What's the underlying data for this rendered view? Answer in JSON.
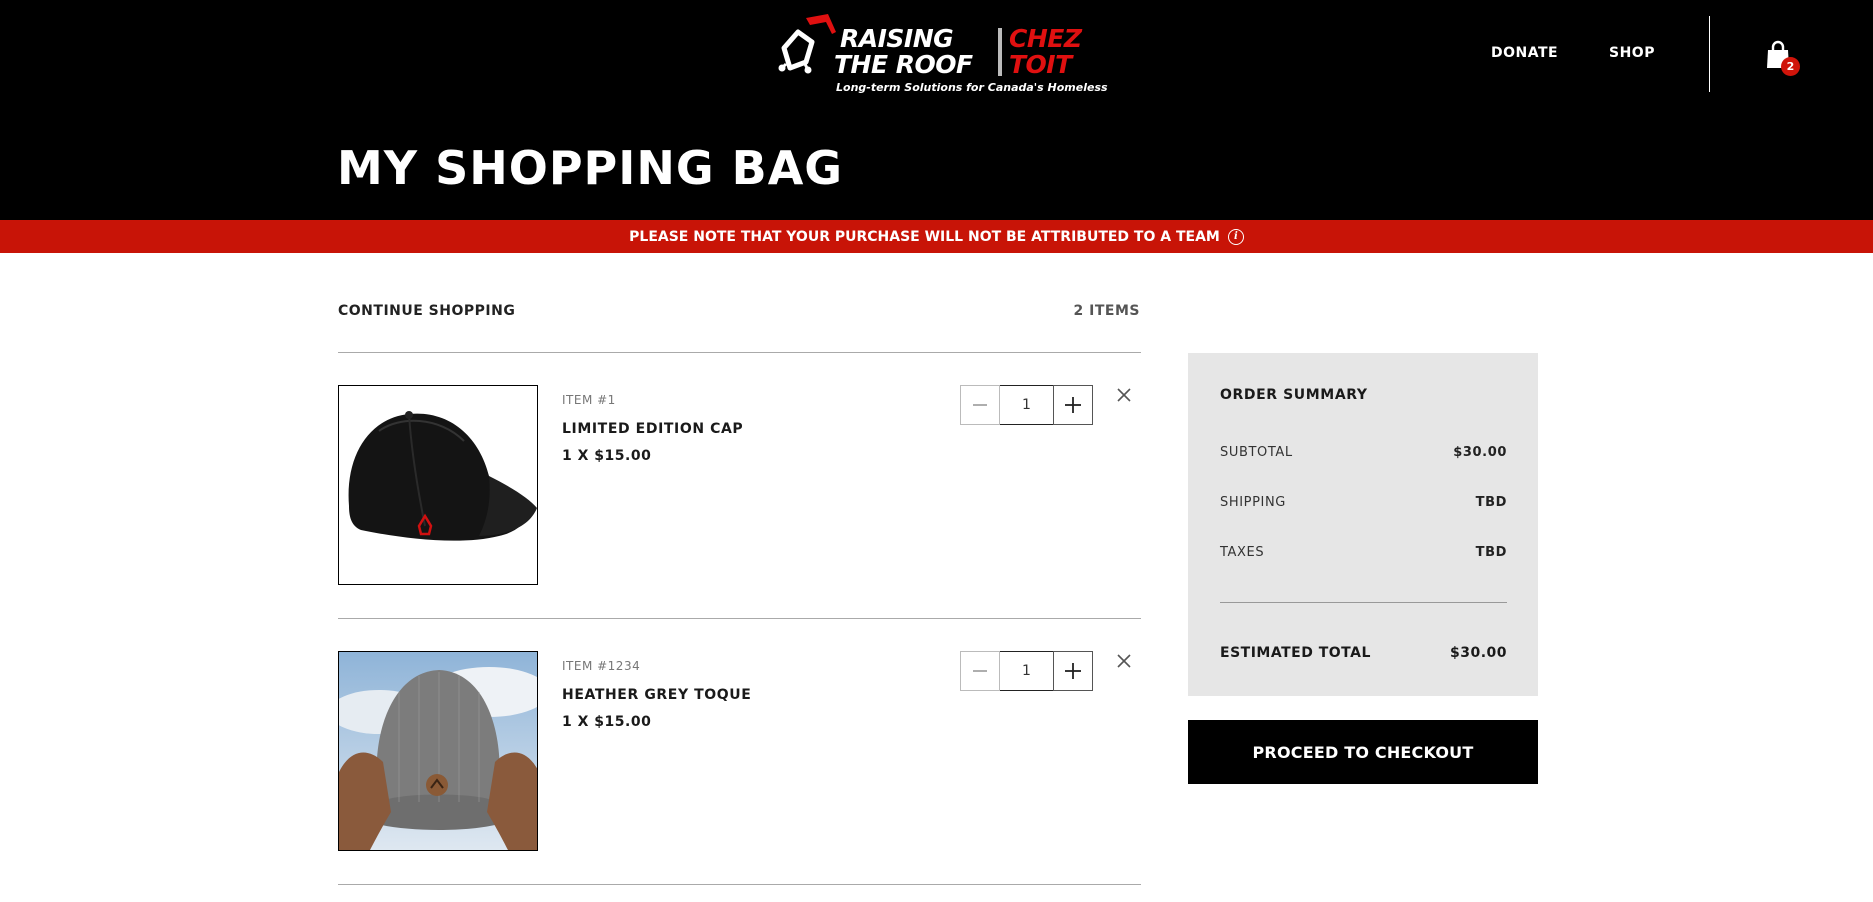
{
  "brand": {
    "line1": "RAISING",
    "line2": "THE ROOF",
    "fr_line1": "CHEZ",
    "fr_line2": "TOIT",
    "tagline": "Long-term Solutions for Canada's Homeless"
  },
  "nav": {
    "donate": "DONATE",
    "shop": "SHOP",
    "cart_count": "2"
  },
  "page": {
    "title": "MY SHOPPING BAG"
  },
  "notice": {
    "text": "PLEASE NOTE THAT YOUR PURCHASE WILL NOT BE ATTRIBUTED TO A TEAM",
    "icon": "info-icon",
    "icon_glyph": "i"
  },
  "cart": {
    "continue_label": "CONTINUE SHOPPING",
    "item_count": "2 ITEMS",
    "items": [
      {
        "number": "ITEM #1",
        "name": "LIMITED EDITION CAP",
        "price": "1 X $15.00",
        "quantity": "1",
        "image": "black-cap-image"
      },
      {
        "number": "ITEM #1234",
        "name": "HEATHER GREY TOQUE",
        "price": "1 X $15.00",
        "quantity": "1",
        "image": "grey-toque-image"
      }
    ]
  },
  "summary": {
    "title": "ORDER SUMMARY",
    "subtotal_label": "SUBTOTAL",
    "subtotal_value": "$30.00",
    "shipping_label": "SHIPPING",
    "shipping_value": "TBD",
    "taxes_label": "TAXES",
    "taxes_value": "TBD",
    "total_label": "ESTIMATED TOTAL",
    "total_value": "$30.00",
    "checkout_label": "PROCEED TO CHECKOUT"
  },
  "colors": {
    "header_bg": "#000000",
    "accent_red": "#c81407",
    "summary_bg": "#e6e6e6"
  }
}
